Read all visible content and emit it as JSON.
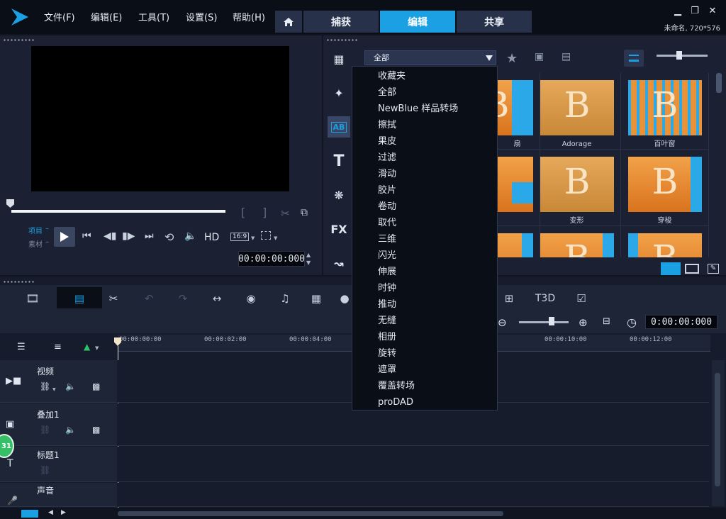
{
  "menu": [
    "文件(F)",
    "编辑(E)",
    "工具(T)",
    "设置(S)",
    "帮助(H)"
  ],
  "tabs": {
    "capture": "捕获",
    "edit": "编辑",
    "share": "共享"
  },
  "project_info": "未命名, 720*576",
  "player": {
    "mode_project": "项目",
    "mode_clip": "素材",
    "hd_label": "HD",
    "aspect": "16:9",
    "timecode": "00:00:00:000",
    "bracket_in": "[",
    "bracket_out": "]"
  },
  "library": {
    "side_text_fx": "FX",
    "side_text_title": "T",
    "side_text_ab": "AB",
    "thumbs": [
      {
        "label": "扇"
      },
      {
        "label": "Adorage"
      },
      {
        "label": "百叶窗"
      },
      {
        "label": "变形"
      },
      {
        "label": "穿梭"
      }
    ],
    "thumb_glyph": "B"
  },
  "dropdown": {
    "selected": "全部",
    "options": [
      "收藏夹",
      "全部",
      "NewBlue 样品转场",
      "擦拭",
      "果皮",
      "过滤",
      "滑动",
      "胶片",
      "卷动",
      "取代",
      "三维",
      "闪光",
      "伸展",
      "时钟",
      "推动",
      "无缝",
      "相册",
      "旋转",
      "遮罩",
      "覆盖转场",
      "proDAD"
    ]
  },
  "timeline": {
    "timecode": "0:00:00:000",
    "ruler": [
      "00:00:00:00",
      "00:00:02:00",
      "00:00:04:00",
      "00:00:10:00",
      "00:00:12:00"
    ],
    "tracks": [
      {
        "name": "视频"
      },
      {
        "name": "叠加1"
      },
      {
        "name": "标题1"
      },
      {
        "name": "声音"
      }
    ],
    "badge": "31",
    "tool_3d": "T3D"
  },
  "colors": {
    "accent": "#1aa0e3",
    "bg": "#0f1420",
    "panel": "#1b2132"
  }
}
